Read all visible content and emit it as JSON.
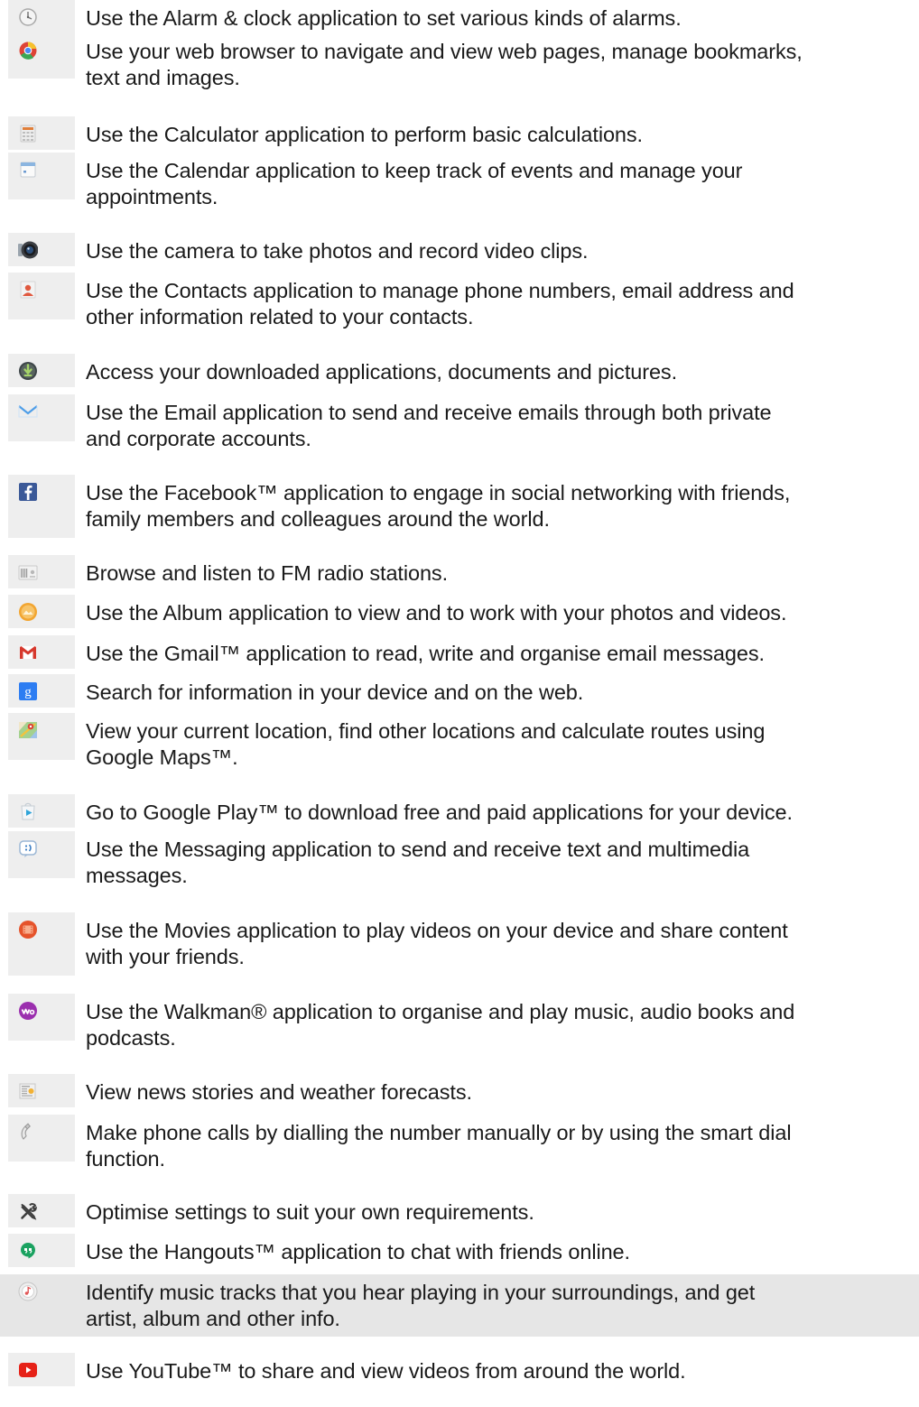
{
  "apps": [
    {
      "icon": "alarm-clock-icon",
      "text": "Use the Alarm & clock application to set various kinds of alarms."
    },
    {
      "icon": "web-browser-icon",
      "text": "Use your web browser to navigate and view web pages, manage bookmarks,\ntext and images."
    },
    {
      "icon": "calculator-icon",
      "text": "Use the Calculator application to perform basic calculations."
    },
    {
      "icon": "calendar-icon",
      "text": "Use the Calendar application to keep track of events and manage your\nappointments."
    },
    {
      "icon": "camera-icon",
      "text": "Use the camera to take photos and record video clips."
    },
    {
      "icon": "contacts-icon",
      "text": "Use the Contacts application to manage phone numbers, email address and\nother information related to your contacts."
    },
    {
      "icon": "download-icon",
      "text": "Access your downloaded applications, documents and pictures."
    },
    {
      "icon": "email-icon",
      "text": "Use the Email application to send and receive emails through both private\nand corporate accounts."
    },
    {
      "icon": "facebook-icon",
      "text": "Use the Facebook™ application to engage in social networking with friends,\nfamily members and colleagues around the world."
    },
    {
      "icon": "fm-radio-icon",
      "text": "Browse and listen to FM radio stations."
    },
    {
      "icon": "album-icon",
      "text": "Use the Album application to view and to work with your photos and videos."
    },
    {
      "icon": "gmail-icon",
      "text": "Use the Gmail™ application to read, write and organise email messages."
    },
    {
      "icon": "google-search-icon",
      "text": "Search for information in your device and on the web."
    },
    {
      "icon": "google-maps-icon",
      "text": "View your current location, find other locations and calculate routes using\nGoogle Maps™."
    },
    {
      "icon": "google-play-icon",
      "text": "Go to Google Play™ to download free and paid applications for your device."
    },
    {
      "icon": "messaging-icon",
      "text": "Use the Messaging application to send and receive text and multimedia\nmessages."
    },
    {
      "icon": "movies-icon",
      "text": "Use the Movies application to play videos on your device and share content\nwith your friends."
    },
    {
      "icon": "walkman-icon",
      "text": "Use the Walkman® application to organise and play music, audio books and\npodcasts."
    },
    {
      "icon": "news-weather-icon",
      "text": "View news stories and weather forecasts."
    },
    {
      "icon": "phone-icon",
      "text": "Make phone calls by dialling the number manually or by using the smart dial\nfunction."
    },
    {
      "icon": "settings-icon",
      "text": "Optimise settings to suit your own requirements."
    },
    {
      "icon": "hangouts-icon",
      "text": "Use the Hangouts™ application to chat with friends online."
    },
    {
      "icon": "trackid-icon",
      "text": "Identify music tracks that you hear playing in your surroundings, and get\nartist, album and other info."
    },
    {
      "icon": "youtube-icon",
      "text": "Use YouTube™ to share and view videos from around the world."
    }
  ],
  "highlighted_row": 22
}
